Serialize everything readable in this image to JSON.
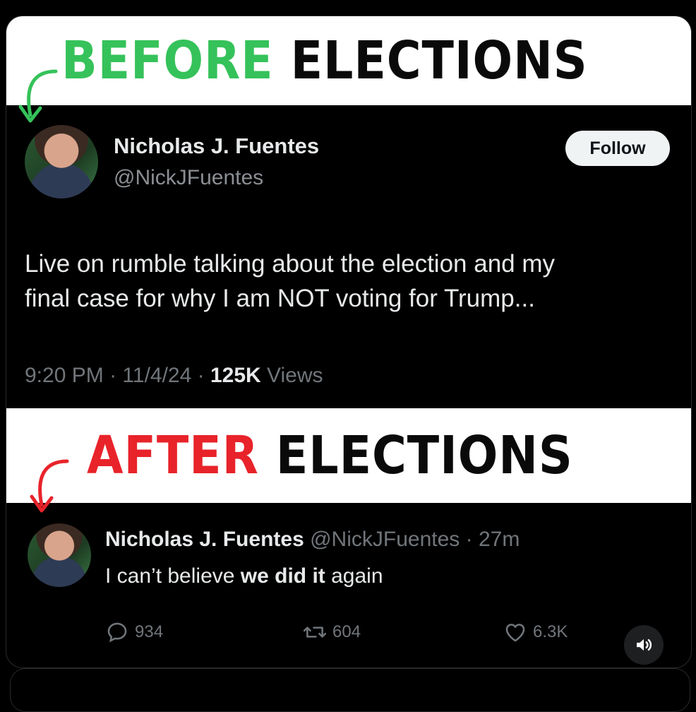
{
  "before_banner": {
    "word1": "BEFORE",
    "word2": "ELECTIONS",
    "word1_color": "#35c25a"
  },
  "after_banner": {
    "word1": "AFTER",
    "word2": "ELECTIONS",
    "word1_color": "#e8232a"
  },
  "tweet1": {
    "name": "Nicholas J. Fuentes",
    "handle": "@NickJFuentes",
    "follow_label": "Follow",
    "text_line1": "Live on rumble talking about the election and my",
    "text_line2": "final case for why I am NOT voting for Trump...",
    "time": "9:20 PM",
    "date": "11/4/24",
    "views_count": "125K",
    "views_label": "Views",
    "sep": "·"
  },
  "tweet2": {
    "name": "Nicholas J. Fuentes",
    "handle": "@NickJFuentes",
    "sep": "·",
    "age": "27m",
    "text_pre": "I can’t believe ",
    "text_bold": "we did it",
    "text_post": " again",
    "replies": "934",
    "retweets": "604",
    "likes": "6.3K"
  },
  "icons": [
    "reply-icon",
    "retweet-icon",
    "like-icon",
    "sound-icon",
    "curved-arrow-icon"
  ]
}
